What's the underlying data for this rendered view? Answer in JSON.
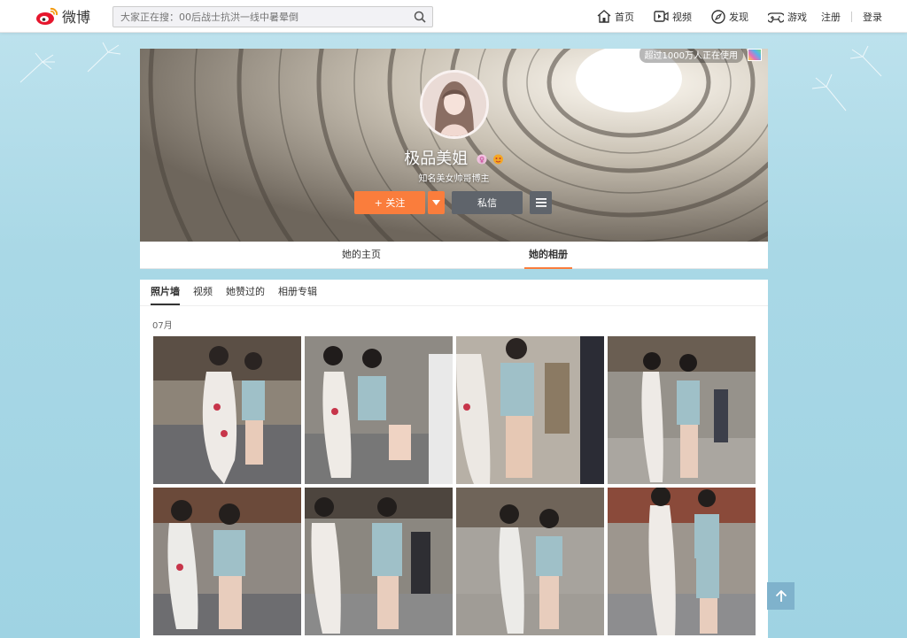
{
  "brand": {
    "name": "微博"
  },
  "search": {
    "placeholder": "大家正在搜：00后战士抗洪一线中暑晕倒"
  },
  "nav": {
    "items": [
      {
        "label": "首页",
        "icon": "home-icon"
      },
      {
        "label": "视频",
        "icon": "video-icon"
      },
      {
        "label": "发现",
        "icon": "compass-icon"
      },
      {
        "label": "游戏",
        "icon": "game-icon"
      }
    ],
    "register": "注册",
    "login": "登录"
  },
  "cover": {
    "usage_badge": "超过1000万人正在使用",
    "username": "极品美姐",
    "description": "知名美女帅哥博主",
    "follow_label": "+ 关注",
    "message_label": "私信"
  },
  "profile_tabs": [
    {
      "label": "她的主页",
      "active": false
    },
    {
      "label": "她的相册",
      "active": true
    }
  ],
  "album": {
    "subtabs": [
      {
        "label": "照片墙",
        "active": true
      },
      {
        "label": "视频",
        "active": false
      },
      {
        "label": "她赞过的",
        "active": false
      },
      {
        "label": "相册专辑",
        "active": false
      }
    ],
    "month": "07月",
    "photo_count": 8
  },
  "colors": {
    "accent": "#fa7d3c",
    "button_dark": "#5f646b",
    "background": "#a9d8e6",
    "back_to_top": "#7fb2cc"
  }
}
